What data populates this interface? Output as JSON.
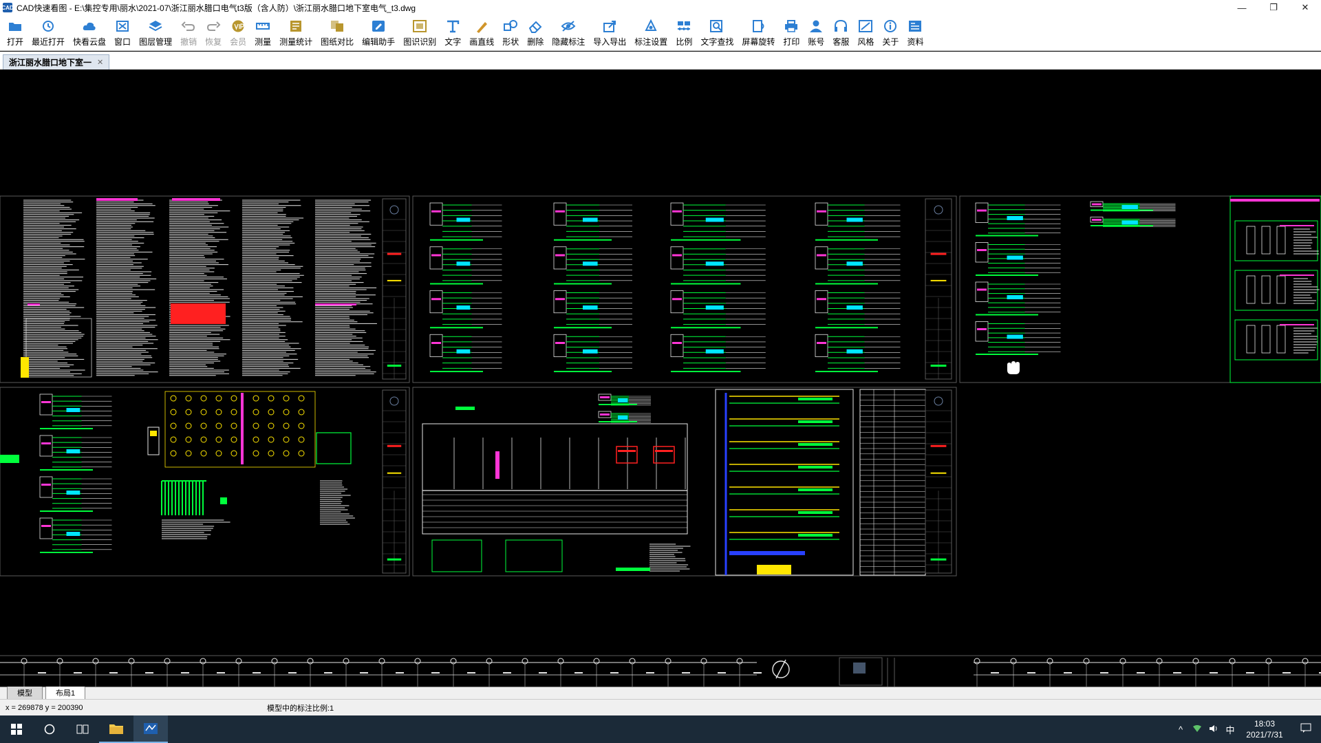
{
  "window": {
    "title": "CAD快速看图 - E:\\集控专用\\丽水\\2021-07\\浙江丽水腊口电气t3版（含人防）\\浙江丽水腊口地下室电气_t3.dwg",
    "minimize": "—",
    "maximize": "❐",
    "close": "✕"
  },
  "toolbar": {
    "items": [
      {
        "id": "open",
        "label": "打开",
        "icon": "folder-icon",
        "color": "#2d7fd3",
        "disabled": false
      },
      {
        "id": "recent",
        "label": "最近打开",
        "icon": "clock-icon",
        "color": "#2d7fd3",
        "disabled": false
      },
      {
        "id": "cloud",
        "label": "快看云盘",
        "icon": "cloud-icon",
        "color": "#2d7fd3",
        "disabled": false
      },
      {
        "id": "window",
        "label": "窗口",
        "icon": "window-icon",
        "color": "#2d7fd3",
        "disabled": false
      },
      {
        "id": "layers",
        "label": "图层管理",
        "icon": "layers-icon",
        "color": "#2d7fd3",
        "disabled": false
      },
      {
        "id": "undo",
        "label": "撤销",
        "icon": "undo-icon",
        "color": "#9a9a9a",
        "disabled": true
      },
      {
        "id": "redo",
        "label": "恢复",
        "icon": "redo-icon",
        "color": "#9a9a9a",
        "disabled": true
      },
      {
        "id": "vip",
        "label": "会员",
        "icon": "vip-icon",
        "color": "#b8962e",
        "disabled": true
      },
      {
        "id": "measure",
        "label": "测量",
        "icon": "ruler-icon",
        "color": "#2d7fd3",
        "disabled": false
      },
      {
        "id": "measure-stats",
        "label": "测量统计",
        "icon": "stats-icon",
        "color": "#b8962e",
        "disabled": false
      },
      {
        "id": "compare",
        "label": "图纸对比",
        "icon": "compare-icon",
        "color": "#b8962e",
        "disabled": false
      },
      {
        "id": "edit-assistant",
        "label": "编辑助手",
        "icon": "edit-assistant-icon",
        "color": "#2d7fd3",
        "disabled": false
      },
      {
        "id": "recognize",
        "label": "图识识别",
        "icon": "recognize-icon",
        "color": "#b8962e",
        "disabled": false
      },
      {
        "id": "text",
        "label": "文字",
        "icon": "text-icon",
        "color": "#2d7fd3",
        "disabled": false
      },
      {
        "id": "draw-line",
        "label": "画直线",
        "icon": "pen-icon",
        "color": "#d0952a",
        "disabled": false
      },
      {
        "id": "shape",
        "label": "形状",
        "icon": "shape-icon",
        "color": "#2d7fd3",
        "disabled": false
      },
      {
        "id": "delete",
        "label": "删除",
        "icon": "eraser-icon",
        "color": "#2d7fd3",
        "disabled": false
      },
      {
        "id": "hide-annot",
        "label": "隐藏标注",
        "icon": "eye-icon",
        "color": "#2d7fd3",
        "disabled": false
      },
      {
        "id": "import-export",
        "label": "导入导出",
        "icon": "import-export-icon",
        "color": "#2d7fd3",
        "disabled": false
      },
      {
        "id": "annot-settings",
        "label": "标注设置",
        "icon": "annot-settings-icon",
        "color": "#2d7fd3",
        "disabled": false
      },
      {
        "id": "scale",
        "label": "比例",
        "icon": "scale-icon",
        "color": "#2d7fd3",
        "disabled": false
      },
      {
        "id": "text-search",
        "label": "文字查找",
        "icon": "text-search-icon",
        "color": "#2d7fd3",
        "disabled": false
      },
      {
        "id": "rotate",
        "label": "屏幕旋转",
        "icon": "rotate-icon",
        "color": "#2d7fd3",
        "disabled": false
      },
      {
        "id": "print",
        "label": "打印",
        "icon": "printer-icon",
        "color": "#2d7fd3",
        "disabled": false
      },
      {
        "id": "account",
        "label": "账号",
        "icon": "user-icon",
        "color": "#2d7fd3",
        "disabled": false
      },
      {
        "id": "support",
        "label": "客服",
        "icon": "headset-icon",
        "color": "#2d7fd3",
        "disabled": false
      },
      {
        "id": "style",
        "label": "风格",
        "icon": "style-icon",
        "color": "#2d7fd3",
        "disabled": false
      },
      {
        "id": "about",
        "label": "关于",
        "icon": "info-icon",
        "color": "#2d7fd3",
        "disabled": false
      },
      {
        "id": "resources",
        "label": "资料",
        "icon": "resources-icon",
        "color": "#2d7fd3",
        "disabled": false
      }
    ]
  },
  "doc_tab": {
    "label": "浙江丽水腊口地下室一",
    "close": "✕"
  },
  "layout_tabs": [
    {
      "label": "模型",
      "active": true
    },
    {
      "label": "布局1",
      "active": false
    }
  ],
  "status": {
    "coords": "x = 269878  y = 200390",
    "scale_text": "模型中的标注比例:1"
  },
  "taskbar": {
    "start_icon": "windows-start-icon",
    "search_icon": "cortana-circle-icon",
    "taskview_icon": "task-view-icon",
    "apps": [
      {
        "name": "file-explorer-icon",
        "active": false
      },
      {
        "name": "cad-viewer-icon",
        "active": true
      }
    ],
    "tray": {
      "chevron": "^",
      "network": "network-icon",
      "volume": "volume-icon",
      "ime": "中",
      "time": "18:03",
      "date": "2021/7/31",
      "notification": "notification-icon"
    }
  },
  "colors": {
    "canvas_bg": "#000000",
    "cad_white": "#e8e8e8",
    "cad_green": "#00ff3c",
    "cad_cyan": "#00e5ff",
    "cad_magenta": "#ff35d6",
    "cad_red": "#ff2020",
    "cad_yellow": "#ffe600",
    "cad_blue": "#2840ff",
    "frame": "#5a5a5a"
  }
}
